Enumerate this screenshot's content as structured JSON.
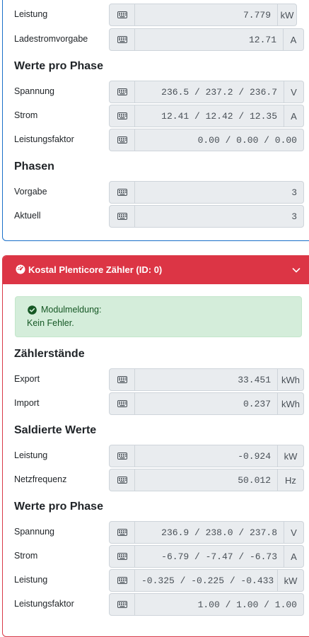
{
  "card1": {
    "rows_top": [
      {
        "label": "Leistung",
        "value": "7.779",
        "unit": "kW"
      },
      {
        "label": "Ladestromvorgabe",
        "value": "12.71",
        "unit": "A"
      }
    ],
    "heading_phase": "Werte pro Phase",
    "rows_phase": [
      {
        "label": "Spannung",
        "value": "236.5 / 237.2 / 236.7",
        "unit": "V"
      },
      {
        "label": "Strom",
        "value": "12.41 / 12.42 / 12.35",
        "unit": "A"
      },
      {
        "label": "Leistungsfaktor",
        "value": "0.00 / 0.00 / 0.00"
      }
    ],
    "heading_phasen": "Phasen",
    "rows_phasen": [
      {
        "label": "Vorgabe",
        "value": "3"
      },
      {
        "label": "Aktuell",
        "value": "3"
      }
    ]
  },
  "card2": {
    "title": "Kostal Plenticore Zähler (ID: 0)",
    "alert": {
      "line1": "Modulmeldung:",
      "line2": "Kein Fehler."
    },
    "heading_counters": "Zählerstände",
    "rows_counters": [
      {
        "label": "Export",
        "value": "33.451",
        "unit": "kWh"
      },
      {
        "label": "Import",
        "value": "0.237",
        "unit": "kWh"
      }
    ],
    "heading_saldiert": "Saldierte Werte",
    "rows_saldiert": [
      {
        "label": "Leistung",
        "value": "-0.924",
        "unit": "kW"
      },
      {
        "label": "Netzfrequenz",
        "value": "50.012",
        "unit": "Hz"
      }
    ],
    "heading_phase": "Werte pro Phase",
    "rows_phase": [
      {
        "label": "Spannung",
        "value": "236.9 / 238.0 / 237.8",
        "unit": "V"
      },
      {
        "label": "Strom",
        "value": "-6.79 / -7.47 / -6.73",
        "unit": "A"
      },
      {
        "label": "Leistung",
        "value": "-0.325 / -0.225 / -0.433",
        "unit": "kW"
      },
      {
        "label": "Leistungsfaktor",
        "value": "1.00 / 1.00 / 1.00"
      }
    ]
  },
  "icons": {
    "input_button": "keyboard-icon",
    "header": "dashboard-icon",
    "alert": "check-circle-icon",
    "collapse": "chevron-down-icon"
  },
  "colors": {
    "primary_border": "#1a6fc9",
    "danger": "#dc3545",
    "success_bg": "#d4edda",
    "success_text": "#155724"
  }
}
